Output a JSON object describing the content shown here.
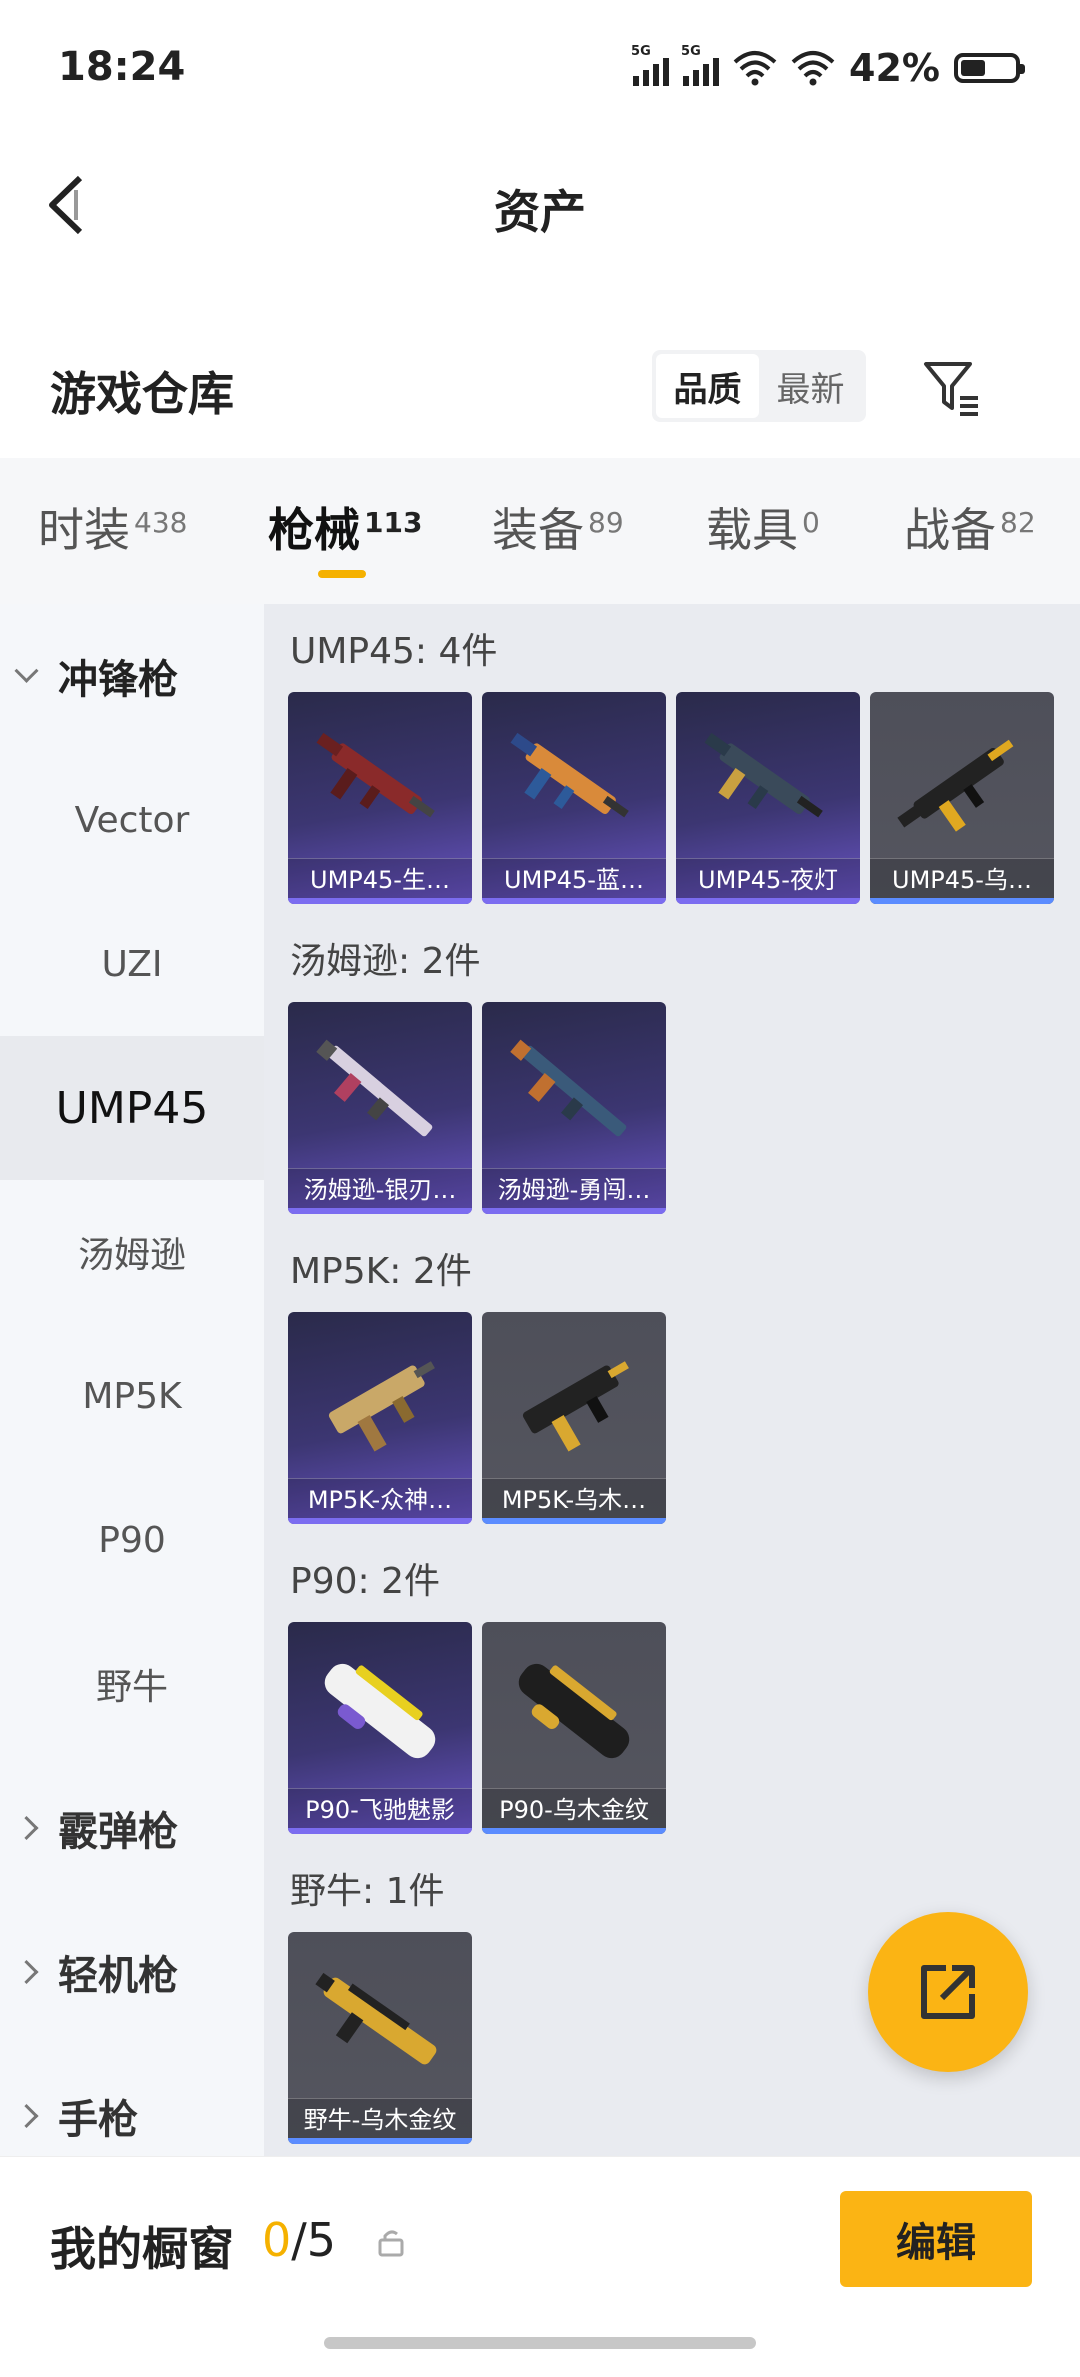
{
  "status_bar": {
    "time": "18:24",
    "network1": "5G",
    "network2": "5G",
    "battery": "42%"
  },
  "header": {
    "title": "资产"
  },
  "warehouse": {
    "title": "游戏仓库",
    "sort_quality": "品质",
    "sort_newest": "最新"
  },
  "tabs": [
    {
      "label": "时装",
      "count": "438"
    },
    {
      "label": "枪械",
      "count": "113"
    },
    {
      "label": "装备",
      "count": "89"
    },
    {
      "label": "载具",
      "count": "0"
    },
    {
      "label": "战备",
      "count": "82"
    }
  ],
  "sidebar": {
    "group_smg": "冲锋枪",
    "items": [
      "Vector",
      "UZI",
      "UMP45",
      "汤姆逊",
      "MP5K",
      "P90",
      "野牛"
    ],
    "group_shotgun": "霰弹枪",
    "group_lmg": "轻机枪",
    "group_pistol": "手枪"
  },
  "groups": [
    {
      "title": "UMP45: 4件",
      "items": [
        "UMP45-生…",
        "UMP45-蓝…",
        "UMP45-夜灯",
        "UMP45-乌…"
      ]
    },
    {
      "title": "汤姆逊: 2件",
      "items": [
        "汤姆逊-银刃…",
        "汤姆逊-勇闯…"
      ]
    },
    {
      "title": "MP5K: 2件",
      "items": [
        "MP5K-众神…",
        "MP5K-乌木…"
      ]
    },
    {
      "title": "P90: 2件",
      "items": [
        "P90-飞驰魅影",
        "P90-乌木金纹"
      ]
    },
    {
      "title": "野牛: 1件",
      "items": [
        "野牛-乌木金纹"
      ]
    }
  ],
  "showcase": {
    "label": "我的橱窗",
    "current": "0",
    "total": "/5",
    "edit": "编辑"
  }
}
